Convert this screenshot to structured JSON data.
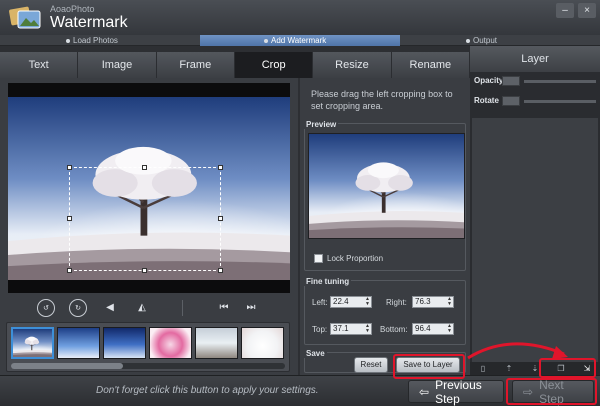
{
  "app": {
    "brand": "AoaoPhoto",
    "title": "Watermark",
    "window_controls": [
      "–",
      "×"
    ]
  },
  "steps": [
    {
      "label": "Load Photos"
    },
    {
      "label": "Add Watermark"
    },
    {
      "label": "Output"
    }
  ],
  "tabs": [
    "Text",
    "Image",
    "Frame",
    "Crop",
    "Resize",
    "Rename"
  ],
  "active_tab": "Crop",
  "crop": {
    "hint": "Please drag the left cropping box to set cropping area.",
    "preview_label": "Preview",
    "lock_label": "Lock Proportion",
    "fine_tuning_label": "Fine tuning",
    "left_label": "Left:",
    "left_value": "22.4",
    "right_label": "Right:",
    "right_value": "76.3",
    "top_label": "Top:",
    "top_value": "37.1",
    "bottom_label": "Bottom:",
    "bottom_value": "96.4",
    "save_label": "Save",
    "reset_label": "Reset",
    "save_to_layer_label": "Save to Layer"
  },
  "layer": {
    "header": "Layer",
    "opacity_label": "Opacity",
    "rotate_label": "Rotate"
  },
  "toolbar_icons": [
    "rotate-left-90-icon",
    "rotate-right-90-icon",
    "flip-horizontal-icon",
    "flip-vertical-icon",
    "previous-photo-icon",
    "next-photo-icon"
  ],
  "bottom": {
    "hint": "Don't forget click this button to apply your settings.",
    "previous_label": "Previous Step",
    "next_label": "Next Step"
  },
  "colors": {
    "accent": "#4f74a8",
    "highlight": "#e0152b"
  }
}
